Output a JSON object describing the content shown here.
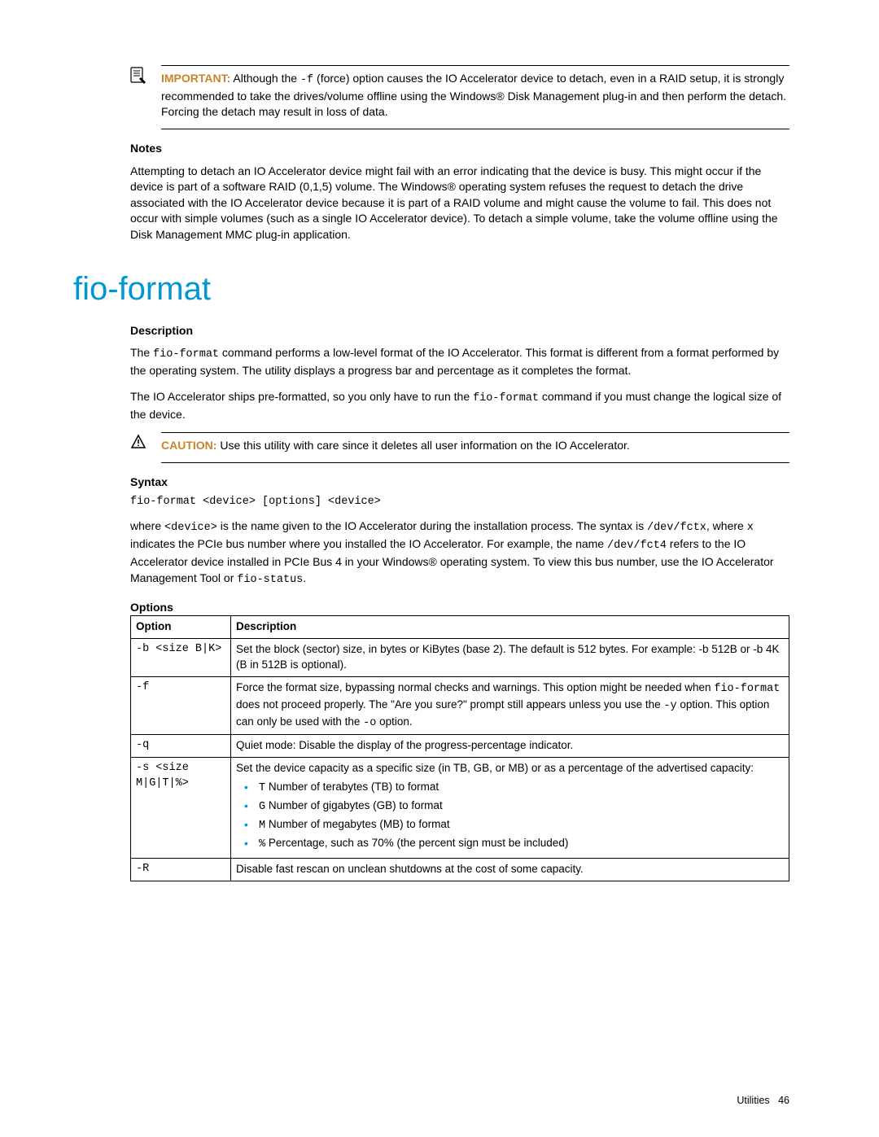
{
  "important": {
    "label": "IMPORTANT:",
    "text_1": "  Although the ",
    "code_1": "-f",
    "text_2": " (force) option causes the IO Accelerator device to detach, even in a RAID setup, it is strongly recommended to take the drives/volume offline using the Windows® Disk Management plug-in and then perform the detach. Forcing the detach may result in loss of data."
  },
  "notes": {
    "heading": "Notes",
    "body": "Attempting to detach an IO Accelerator device might fail with an error indicating that the device is busy. This might occur if the device is part of a software RAID (0,1,5) volume. The Windows® operating system refuses the request to detach the drive associated with the IO Accelerator device because it is part of a RAID volume and might cause the volume to fail. This does not occur with simple volumes (such as a single IO Accelerator device). To detach a simple volume, take the volume offline using the Disk Management MMC plug-in application."
  },
  "title": "fio-format",
  "description": {
    "heading": "Description",
    "p1_a": "The ",
    "p1_code": "fio-format",
    "p1_b": " command performs a low-level format of the IO Accelerator. This format is different from a format performed by the operating system. The utility displays a progress bar and percentage as it completes the format.",
    "p2_a": "The IO Accelerator ships pre-formatted, so you only have to run the ",
    "p2_code": "fio-format",
    "p2_b": " command if you must change the logical size of the device."
  },
  "caution": {
    "label": "CAUTION:",
    "text": "  Use this utility with care since it deletes all user information on the IO Accelerator."
  },
  "syntax": {
    "heading": "Syntax",
    "code": "fio-format <device> [options] <device>",
    "p_a": "where ",
    "p_code1": "<device>",
    "p_b": " is the name given to the IO Accelerator during the installation process. The syntax is ",
    "p_code2": "/dev/fctx",
    "p_c": ", where ",
    "p_code3": "x",
    "p_d": " indicates the PCIe bus number where you installed the IO Accelerator. For example, the name ",
    "p_code4": "/dev/fct4",
    "p_e": " refers to the IO Accelerator device installed in PCIe Bus 4 in your Windows® operating system. To view this bus number, use the IO Accelerator Management Tool or ",
    "p_code5": "fio-status",
    "p_f": "."
  },
  "options": {
    "heading": "Options",
    "col1": "Option",
    "col2": "Description",
    "rows": [
      {
        "opt": "-b <size B|K>",
        "desc_plain": "Set the block (sector) size, in bytes or KiBytes (base 2). The default is 512 bytes. For example: -b 512B or -b 4K (B in 512B is optional)."
      },
      {
        "opt": "-f",
        "desc_a": "Force the format size, bypassing normal checks and warnings. This option might be needed when ",
        "desc_code1": "fio-format",
        "desc_b": " does not proceed properly. The \"Are you sure?\" prompt still appears unless you use the ",
        "desc_code2": "-y",
        "desc_c": " option. This option can only be used with the ",
        "desc_code3": "-o",
        "desc_d": " option."
      },
      {
        "opt": "-q",
        "desc_plain": "Quiet mode: Disable the display of the progress-percentage indicator."
      },
      {
        "opt": "-s <size M|G|T|%>",
        "desc_plain": "Set the device capacity as a specific size (in TB, GB, or MB) or as a percentage of the advertised capacity:",
        "bullets": [
          {
            "code": "T",
            "text": " Number of terabytes (TB) to format"
          },
          {
            "code": "G",
            "text": " Number of gigabytes (GB) to format"
          },
          {
            "code": "M",
            "text": " Number of megabytes (MB) to format"
          },
          {
            "code": "%",
            "text": " Percentage, such as 70% (the percent sign must be included)"
          }
        ]
      },
      {
        "opt": "-R",
        "desc_plain": "Disable fast rescan on unclean shutdowns at the cost of some capacity."
      }
    ]
  },
  "footer": {
    "section": "Utilities",
    "page": "46"
  }
}
